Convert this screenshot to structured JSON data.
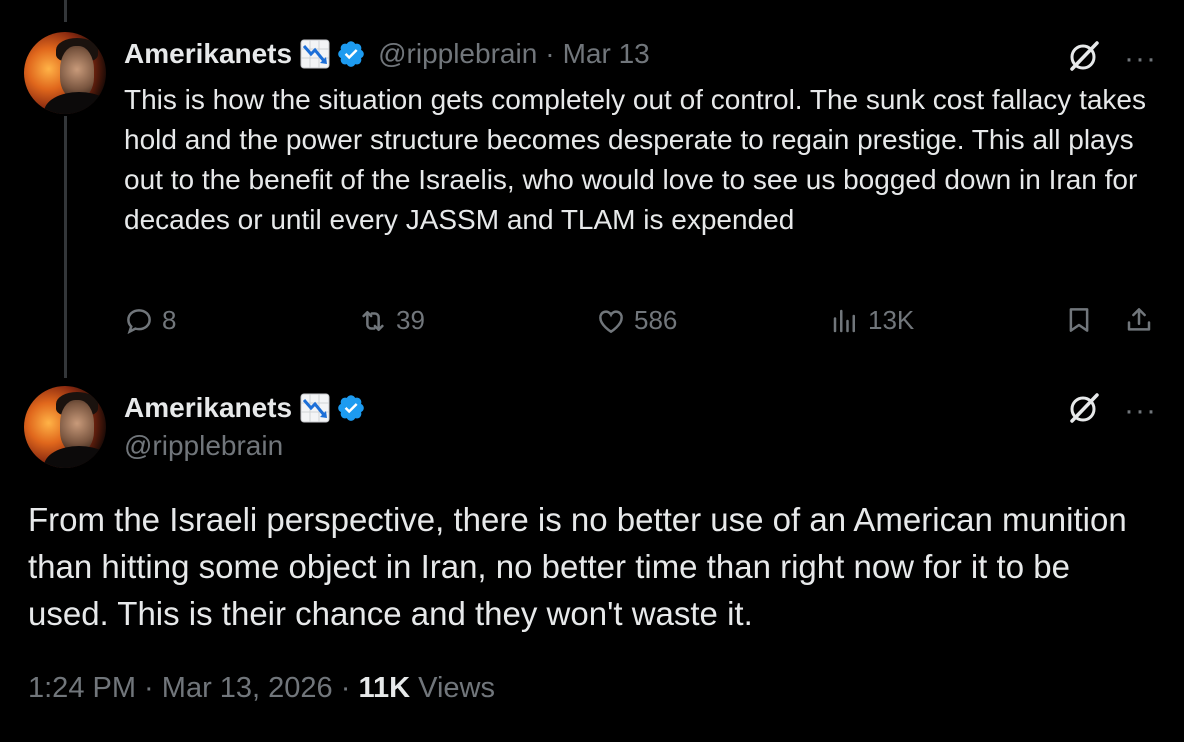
{
  "tweet1": {
    "author_name": "Amerikanets",
    "author_handle": "@ripplebrain",
    "separator": "·",
    "date": "Mar 13",
    "text": "This is how the situation gets completely out of control. The sunk cost fallacy takes hold and the power structure becomes desperate to regain prestige. This all plays out to the benefit of the Israelis, who would love to see us bogged down in Iran for decades or until every JASSM and TLAM is expended",
    "replies": "8",
    "retweets": "39",
    "likes": "586",
    "views": "13K",
    "more": "···"
  },
  "tweet2": {
    "author_name": "Amerikanets",
    "author_handle": "@ripplebrain",
    "text": "From the Israeli perspective, there is no better use of an American munition than hitting some object in Iran, no better time than right now for it to be used. This is their chance and they won't waste it.",
    "time": "1:24 PM",
    "sep1": " · ",
    "date": "Mar 13, 2026",
    "sep2": " · ",
    "view_count": "11K",
    "views_label": " Views",
    "more": "···"
  },
  "icons": {
    "reply": "reply-icon",
    "retweet": "retweet-icon",
    "like": "like-icon",
    "views": "analytics-icon",
    "bookmark": "bookmark-icon",
    "share": "share-icon",
    "grok": "grok-icon",
    "verified": "verified-badge-icon",
    "flag": "chart-decreasing-emoji"
  },
  "colors": {
    "background": "#000000",
    "text": "#e7e9ea",
    "muted": "#71767b",
    "verified": "#1d9bf0"
  }
}
